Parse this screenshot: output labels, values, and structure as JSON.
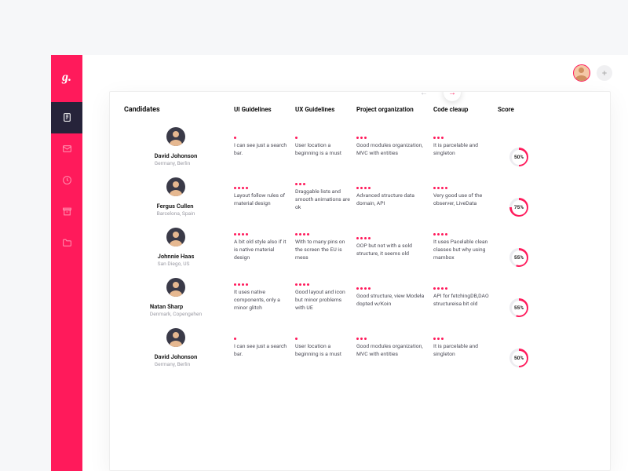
{
  "brand": {
    "logo_text": "g."
  },
  "sidebar": {
    "items": [
      {
        "name": "nav-tasks",
        "active": true
      },
      {
        "name": "nav-mail",
        "active": false
      },
      {
        "name": "nav-clock",
        "active": false
      },
      {
        "name": "nav-archive",
        "active": false
      },
      {
        "name": "nav-folder",
        "active": false
      }
    ]
  },
  "topbar": {
    "add_label": "+"
  },
  "table": {
    "columns": [
      {
        "key": "candidate",
        "label": "Candidates"
      },
      {
        "key": "ui",
        "label": "UI Guidelines"
      },
      {
        "key": "ux",
        "label": "UX Guidelines"
      },
      {
        "key": "po",
        "label": "Project organization"
      },
      {
        "key": "cc",
        "label": "Code cleaup"
      },
      {
        "key": "score",
        "label": "Score"
      }
    ],
    "rows": [
      {
        "name": "David Johonson",
        "location": "Germany, Berlin",
        "ui": {
          "rating": 1,
          "note": "I can see just a search bar."
        },
        "ux": {
          "rating": 1,
          "note": "User location a beginning is a must"
        },
        "po": {
          "rating": 3,
          "note": "Good modules organization, MVC with entities"
        },
        "cc": {
          "rating": 3,
          "note": "It is parcelable and singleton"
        },
        "score": 50
      },
      {
        "name": "Fergus Cullen",
        "location": "Barcelona, Spain",
        "ui": {
          "rating": 4,
          "note": "Layout follow rules of material design"
        },
        "ux": {
          "rating": 3,
          "note": "Draggable lists and smooth animations are ok"
        },
        "po": {
          "rating": 4,
          "note": "Advanced structure data domain, API"
        },
        "cc": {
          "rating": 4,
          "note": "Very good use of the observer, LiveData"
        },
        "score": 75
      },
      {
        "name": "Johnnie Haas",
        "location": "San Diego, US",
        "ui": {
          "rating": 4,
          "note": "A bit old style also if it is native material design"
        },
        "ux": {
          "rating": 4,
          "note": "With to many pins on the screen the EU is mess"
        },
        "po": {
          "rating": 4,
          "note": "OOP but not with a sold structure, it seems old"
        },
        "cc": {
          "rating": 4,
          "note": "It uses Pacelable clean classes but why using mambox"
        },
        "score": 55
      },
      {
        "name": "Natan Sharp",
        "location": "Denmark, Copengehen",
        "ui": {
          "rating": 4,
          "note": "It uses native components, only a minor glitch"
        },
        "ux": {
          "rating": 4,
          "note": "Good layout and icon but minor problems with UE"
        },
        "po": {
          "rating": 4,
          "note": "Good structure, view Modeła dopted w/Koin"
        },
        "cc": {
          "rating": 4,
          "note": "API for fetchingDB,DAO structureisa bit old"
        },
        "score": 55
      },
      {
        "name": "David Johonson",
        "location": "Germany, Berlin",
        "ui": {
          "rating": 1,
          "note": "I can see just a search bar."
        },
        "ux": {
          "rating": 1,
          "note": "User location a beginning is a must"
        },
        "po": {
          "rating": 3,
          "note": "Good modules organization, MVC with entities"
        },
        "cc": {
          "rating": 3,
          "note": "It is parcelable and singleton"
        },
        "score": 50
      }
    ]
  },
  "colors": {
    "accent": "#ff1a5b",
    "dark": "#26233a"
  }
}
